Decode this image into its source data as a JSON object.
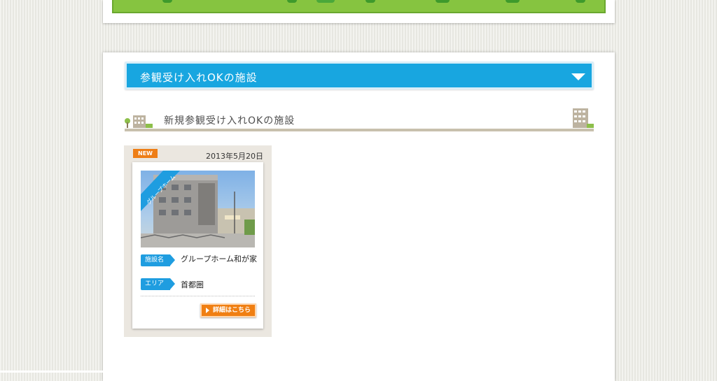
{
  "section": {
    "title": "参観受け入れOKの施設"
  },
  "subsection": {
    "title": "新規参観受け入れOKの施設"
  },
  "card": {
    "badge": "NEW",
    "date": "2013年5月20日",
    "ribbon": "グループホーム",
    "name_label": "施設名",
    "name_value": "グループホーム和が家",
    "area_label": "エリア",
    "area_value": "首都圏",
    "detail_button": "詳細はこちら"
  },
  "colors": {
    "accent_blue": "#18a6e0",
    "accent_orange": "#f07f12",
    "banner_green": "#86c440"
  }
}
